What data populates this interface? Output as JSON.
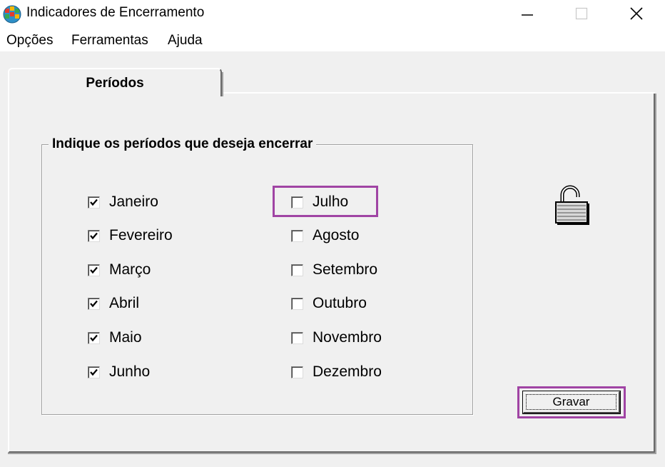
{
  "window": {
    "title": "Indicadores de Encerramento"
  },
  "menu": {
    "items": [
      "Opções",
      "Ferramentas",
      "Ajuda"
    ]
  },
  "tab": {
    "label": "Períodos"
  },
  "group": {
    "label": "Indique os períodos que deseja encerrar"
  },
  "months_left": [
    {
      "label": "Janeiro",
      "checked": true
    },
    {
      "label": "Fevereiro",
      "checked": true
    },
    {
      "label": "Março",
      "checked": true
    },
    {
      "label": "Abril",
      "checked": true
    },
    {
      "label": "Maio",
      "checked": true
    },
    {
      "label": "Junho",
      "checked": true
    }
  ],
  "months_right": [
    {
      "label": "Julho",
      "checked": false
    },
    {
      "label": "Agosto",
      "checked": false
    },
    {
      "label": "Setembro",
      "checked": false
    },
    {
      "label": "Outubro",
      "checked": false
    },
    {
      "label": "Novembro",
      "checked": false
    },
    {
      "label": "Dezembro",
      "checked": false
    }
  ],
  "buttons": {
    "save_label": "Gravar"
  },
  "icons": {
    "app": "globe-icon",
    "status": "open-padlock-icon"
  },
  "colors": {
    "highlight": "#a044a4",
    "background": "#f0f0f0"
  }
}
